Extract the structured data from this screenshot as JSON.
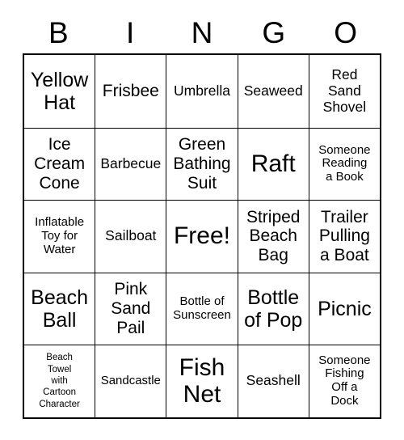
{
  "card": {
    "header": {
      "letters": [
        "B",
        "I",
        "N",
        "G",
        "O"
      ]
    },
    "rows": [
      [
        {
          "text": "Yellow\nHat",
          "size": "xl"
        },
        {
          "text": "Frisbee",
          "size": "lg"
        },
        {
          "text": "Umbrella",
          "size": "md"
        },
        {
          "text": "Seaweed",
          "size": "md"
        },
        {
          "text": "Red\nSand\nShovel",
          "size": "md"
        }
      ],
      [
        {
          "text": "Ice\nCream\nCone",
          "size": "lg"
        },
        {
          "text": "Barbecue",
          "size": "md"
        },
        {
          "text": "Green\nBathing\nSuit",
          "size": "lg"
        },
        {
          "text": "Raft",
          "size": "xxl"
        },
        {
          "text": "Someone\nReading\na Book",
          "size": "sm"
        }
      ],
      [
        {
          "text": "Inflatable\nToy for\nWater",
          "size": "sm"
        },
        {
          "text": "Sailboat",
          "size": "md"
        },
        {
          "text": "Free!",
          "size": "xxl"
        },
        {
          "text": "Striped\nBeach\nBag",
          "size": "lg"
        },
        {
          "text": "Trailer\nPulling\na Boat",
          "size": "lg"
        }
      ],
      [
        {
          "text": "Beach\nBall",
          "size": "xl"
        },
        {
          "text": "Pink\nSand\nPail",
          "size": "lg"
        },
        {
          "text": "Bottle of\nSunscreen",
          "size": "sm"
        },
        {
          "text": "Bottle\nof Pop",
          "size": "xl"
        },
        {
          "text": "Picnic",
          "size": "xl"
        }
      ],
      [
        {
          "text": "Beach\nTowel\nwith\nCartoon\nCharacter",
          "size": "xs"
        },
        {
          "text": "Sandcastle",
          "size": "sm"
        },
        {
          "text": "Fish\nNet",
          "size": "xxl"
        },
        {
          "text": "Seashell",
          "size": "md"
        },
        {
          "text": "Someone\nFishing\nOff a\nDock",
          "size": "sm"
        }
      ]
    ]
  },
  "colors": {
    "background": "#ffffff",
    "border": "#000000",
    "text": "#000000"
  }
}
